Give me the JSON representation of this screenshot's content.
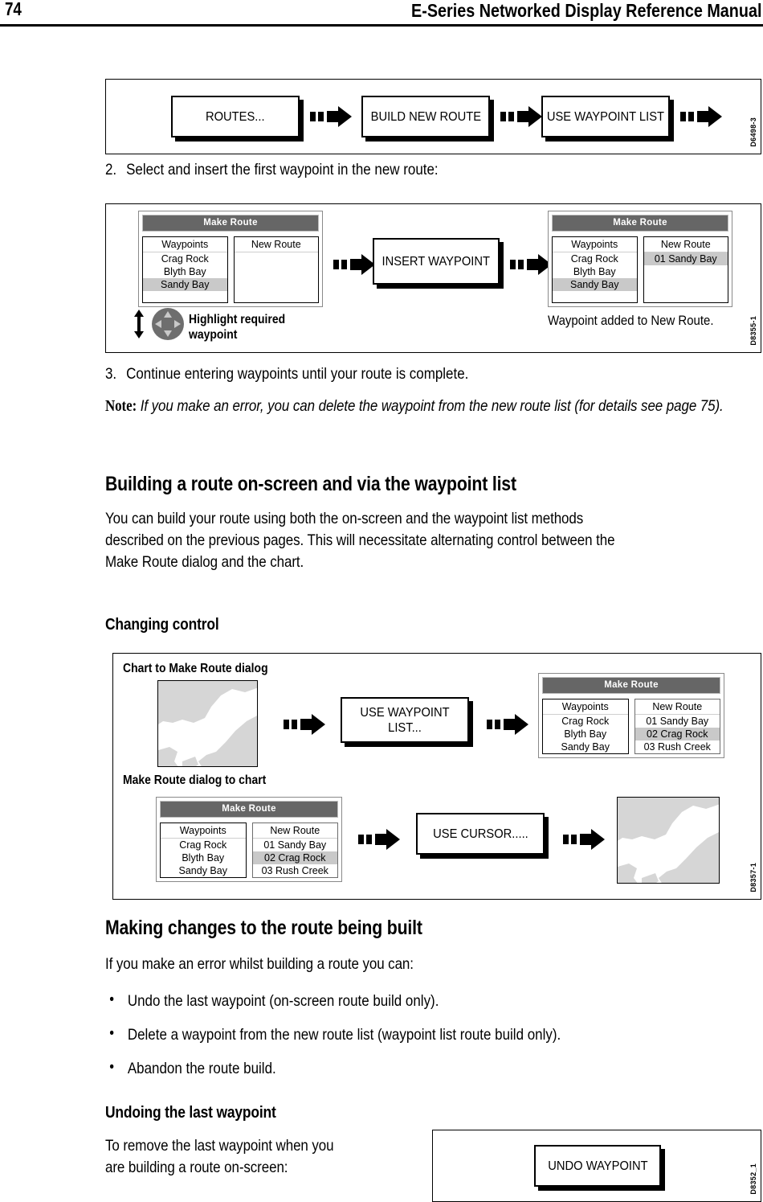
{
  "header": {
    "page_number": "74",
    "title": "E-Series Networked Display Reference Manual"
  },
  "figure1": {
    "code": "D6498-3",
    "buttons": [
      {
        "label": "ROUTES..."
      },
      {
        "label": "BUILD NEW ROUTE"
      },
      {
        "label": "USE WAYPOINT LIST"
      }
    ]
  },
  "step2": {
    "number": "2.",
    "text": "Select and insert the first waypoint in the new route:"
  },
  "figure2": {
    "code": "D8355-1",
    "dialog_left": {
      "title": "Make Route",
      "left_col_header": "Waypoints",
      "left_col_items": [
        "Crag Rock",
        "Blyth Bay",
        "Sandy Bay"
      ],
      "left_selected": "Sandy Bay",
      "right_col_header": "New Route",
      "right_col_items": []
    },
    "caption_left": "Highlight required waypoint",
    "button": {
      "label": "INSERT WAYPOINT"
    },
    "dialog_right": {
      "title": "Make Route",
      "left_col_header": "Waypoints",
      "left_col_items": [
        "Crag Rock",
        "Blyth Bay",
        "Sandy Bay"
      ],
      "left_selected": "Sandy Bay",
      "right_col_header": "New Route",
      "right_col_items": [
        "01 Sandy Bay"
      ],
      "right_selected": "01 Sandy Bay"
    },
    "caption_right": "Waypoint added to New Route."
  },
  "step3": {
    "number": "3.",
    "text": "Continue entering waypoints until your route is complete."
  },
  "note": {
    "label": "Note:",
    "text": "If you make an error, you can delete the waypoint from the new route list (for details see page 75)."
  },
  "section_building": {
    "heading": "Building a route on-screen and via the waypoint list",
    "paragraph_line1": "You can build your route using both the on-screen and the waypoint list methods",
    "paragraph_line2": "described on the previous pages. This will necessitate alternating control between the",
    "paragraph_line3": "Make Route dialog and the chart."
  },
  "subsection_changing_control": {
    "heading": "Changing control"
  },
  "figure3": {
    "code": "D8357-1",
    "row1_label": "Chart to Make Route dialog",
    "row1_button": {
      "label": "USE WAYPOINT LIST..."
    },
    "row1_dialog": {
      "title": "Make Route",
      "left_col_header": "Waypoints",
      "left_col_items": [
        "Crag Rock",
        "Blyth Bay",
        "Sandy Bay"
      ],
      "right_col_header": "New Route",
      "right_col_items": [
        "01 Sandy Bay",
        "02 Crag Rock",
        "03 Rush Creek"
      ],
      "right_selected": "02 Crag Rock"
    },
    "row2_label": "Make Route dialog to chart",
    "row2_dialog": {
      "title": "Make Route",
      "left_col_header": "Waypoints",
      "left_col_items": [
        "Crag Rock",
        "Blyth Bay",
        "Sandy Bay"
      ],
      "right_col_header": "New Route",
      "right_col_items": [
        "01 Sandy Bay",
        "02 Crag Rock",
        "03 Rush Creek"
      ],
      "right_selected": "02 Crag Rock"
    },
    "row2_button": {
      "label": "USE CURSOR....."
    }
  },
  "section_making_changes": {
    "heading": "Making changes to the route being built",
    "intro": "If you make an error whilst building a route you can:",
    "bullets": [
      "Undo the last waypoint (on-screen route build only).",
      "Delete a waypoint from the new route list (waypoint list route build only).",
      "Abandon the route build."
    ]
  },
  "subsection_undoing": {
    "heading": "Undoing the last waypoint",
    "paragraph_line1": "To remove the last waypoint when you",
    "paragraph_line2": "are building a route on-screen:"
  },
  "figure4": {
    "code": "D8352_1",
    "button": {
      "label": "UNDO WAYPOINT"
    }
  },
  "colors": {
    "dialog_titlebar": "#666666",
    "selection_highlight": "#c9c9c9",
    "land_fill": "#d6d6d6",
    "trackpad_fill": "#6e6e6e"
  }
}
